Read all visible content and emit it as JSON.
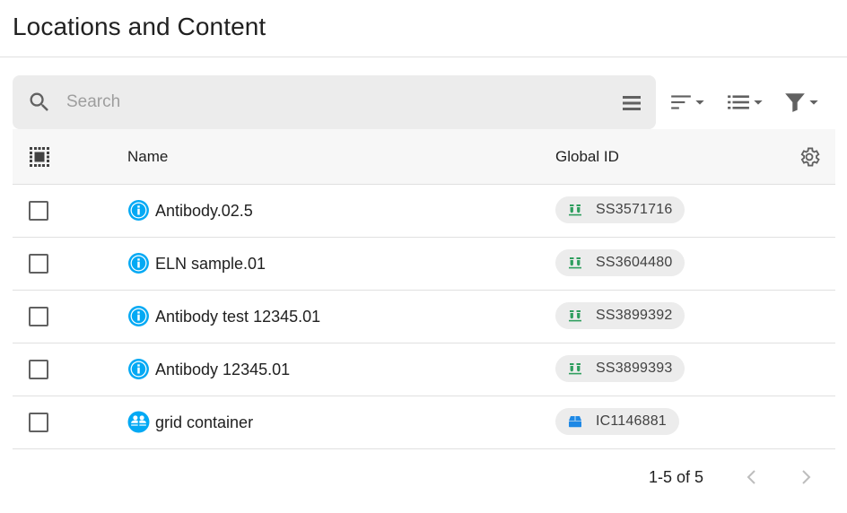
{
  "page": {
    "title": "Locations and Content"
  },
  "search": {
    "placeholder": "Search",
    "value": ""
  },
  "toolbar": {
    "sort_icon": "sort-icon",
    "view_icon": "list-view-icon",
    "filter_icon": "filter-icon"
  },
  "table": {
    "columns": {
      "name": "Name",
      "global_id": "Global ID"
    },
    "rows": [
      {
        "name": "Antibody.02.5",
        "global_id": "SS3571716",
        "type": "subsample",
        "selected": false
      },
      {
        "name": "ELN sample.01",
        "global_id": "SS3604480",
        "type": "subsample",
        "selected": false
      },
      {
        "name": "Antibody test 12345.01",
        "global_id": "SS3899392",
        "type": "subsample",
        "selected": false
      },
      {
        "name": "Antibody 12345.01",
        "global_id": "SS3899393",
        "type": "subsample",
        "selected": false
      },
      {
        "name": "grid container",
        "global_id": "IC1146881",
        "type": "container",
        "selected": false
      }
    ]
  },
  "pagination": {
    "range_text": "1-5 of 5"
  },
  "colors": {
    "info_icon": "#03a9f4",
    "subsample_icon": "#2e9e5e",
    "container_icon": "#1e88e5"
  }
}
